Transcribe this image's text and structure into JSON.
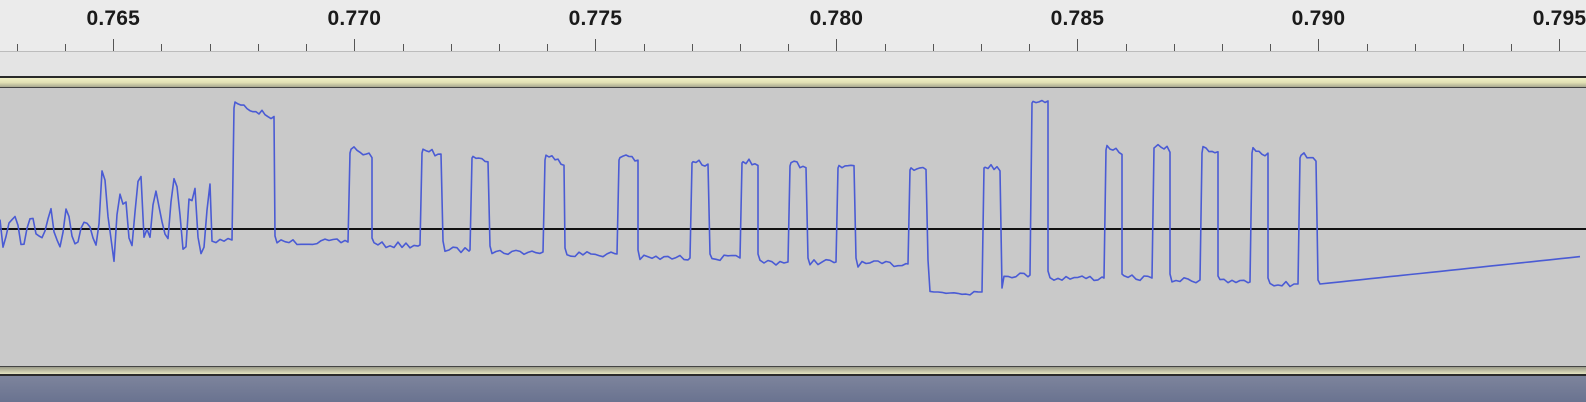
{
  "timeline": {
    "ticks": [
      "0.765",
      "0.770",
      "0.775",
      "0.780",
      "0.785",
      "0.790",
      "0.795"
    ],
    "start": 0.76265,
    "end": 0.79555
  },
  "track": {
    "waveform_color": "#4a5bd4",
    "background_color": "#c9c9c9",
    "centerline_color": "#111111"
  }
}
